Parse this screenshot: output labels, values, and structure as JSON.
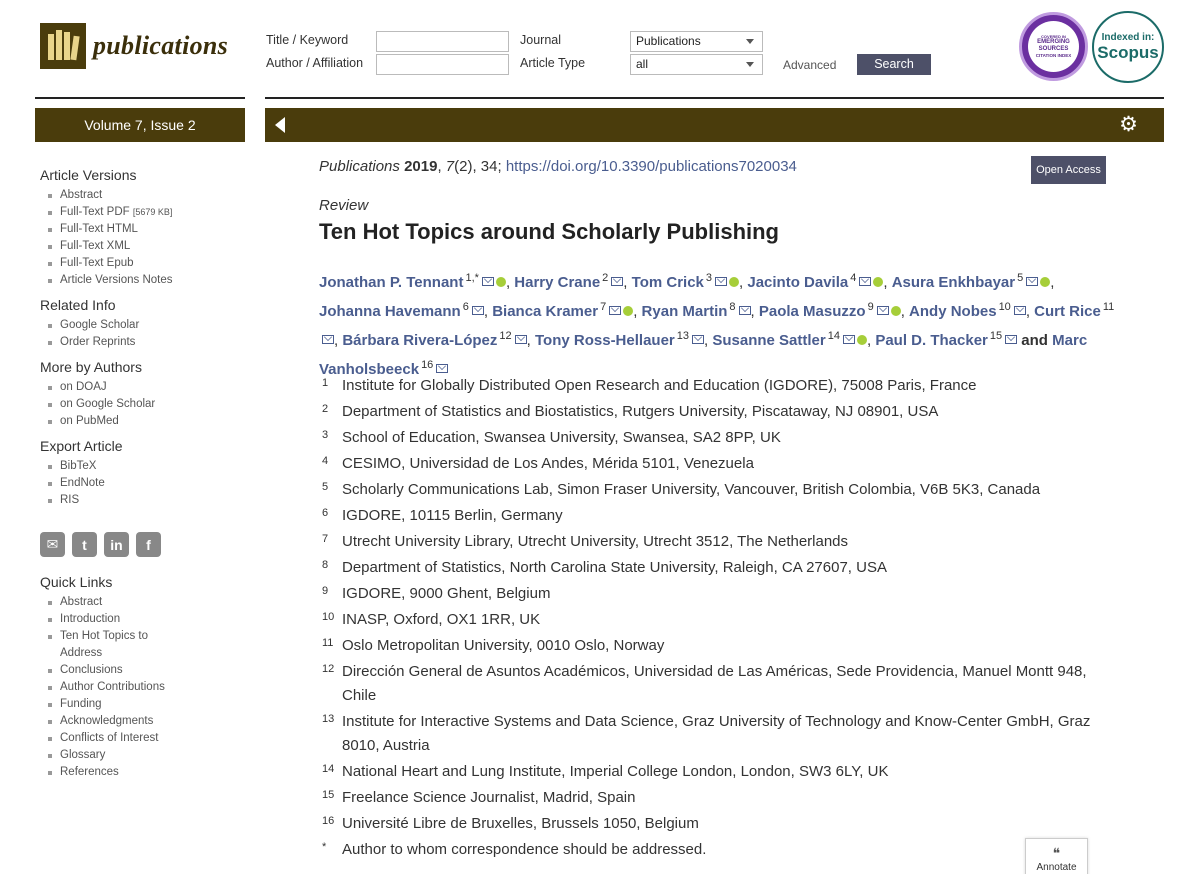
{
  "header": {
    "logo_text": "publications",
    "search": {
      "title_keyword_label": "Title / Keyword",
      "author_affiliation_label": "Author / Affiliation",
      "journal_label": "Journal",
      "journal_value": "Publications",
      "article_type_label": "Article Type",
      "article_type_value": "all",
      "advanced_label": "Advanced",
      "search_label": "Search"
    },
    "badges": {
      "esci_line1": "COVERED IN",
      "esci_line2": "EMERGING",
      "esci_line3": "SOURCES",
      "esci_line4": "CITATION INDEX",
      "scopus_line1": "Indexed in:",
      "scopus_line2": "Scopus"
    }
  },
  "volume_bar": "Volume 7, Issue 2",
  "sidebar": {
    "sections": [
      {
        "heading": "Article Versions",
        "items": [
          "Abstract",
          "Full-Text PDF",
          "Full-Text HTML",
          "Full-Text XML",
          "Full-Text Epub",
          "Article Versions Notes"
        ]
      },
      {
        "heading": "Related Info",
        "items": [
          "Google Scholar",
          "Order Reprints"
        ]
      },
      {
        "heading": "More by Authors",
        "items": [
          "on DOAJ",
          "on Google Scholar",
          "on PubMed"
        ]
      },
      {
        "heading": "Export Article",
        "items": [
          "BibTeX",
          "EndNote",
          "RIS"
        ]
      }
    ],
    "pdf_size": "[5679 KB]",
    "social_icons": [
      "email-icon",
      "twitter-icon",
      "linkedin-icon",
      "facebook-icon"
    ],
    "quick_links": {
      "heading": "Quick Links",
      "items": [
        "Abstract",
        "Introduction",
        "Ten Hot Topics to Address",
        "Conclusions",
        "Author Contributions",
        "Funding",
        "Acknowledgments",
        "Conflicts of Interest",
        "Glossary",
        "References"
      ]
    }
  },
  "article": {
    "journal": "Publications",
    "year": "2019",
    "volume": "7",
    "issue": "(2)",
    "article_no": ", 34; ",
    "doi": "https://doi.org/10.3390/publications7020034",
    "open_access": "Open Access",
    "type": "Review",
    "title": "Ten Hot Topics around Scholarly Publishing",
    "authors": [
      {
        "name": "Jonathan P. Tennant",
        "sup": "1,*",
        "orcid": true
      },
      {
        "name": "Harry Crane",
        "sup": "2",
        "orcid": false
      },
      {
        "name": "Tom Crick",
        "sup": "3",
        "orcid": true
      },
      {
        "name": "Jacinto Davila",
        "sup": "4",
        "orcid": true
      },
      {
        "name": "Asura Enkhbayar",
        "sup": "5",
        "orcid": true
      },
      {
        "name": "Johanna Havemann",
        "sup": "6",
        "orcid": false
      },
      {
        "name": "Bianca Kramer",
        "sup": "7",
        "orcid": true
      },
      {
        "name": "Ryan Martin",
        "sup": "8",
        "orcid": false
      },
      {
        "name": "Paola Masuzzo",
        "sup": "9",
        "orcid": true
      },
      {
        "name": "Andy Nobes",
        "sup": "10",
        "orcid": false
      },
      {
        "name": "Curt Rice",
        "sup": "11",
        "orcid": false
      },
      {
        "name": "Bárbara Rivera-López",
        "sup": "12",
        "orcid": false
      },
      {
        "name": "Tony Ross-Hellauer",
        "sup": "13",
        "orcid": false
      },
      {
        "name": "Susanne Sattler",
        "sup": "14",
        "orcid": true
      },
      {
        "name": "Paul D. Thacker",
        "sup": "15",
        "orcid": false
      },
      {
        "name": "Marc Vanholsbeeck",
        "sup": "16",
        "orcid": false
      }
    ],
    "and_word": "and",
    "affiliations": [
      {
        "num": "1",
        "text": "Institute for Globally Distributed Open Research and Education (IGDORE), 75008 Paris, France"
      },
      {
        "num": "2",
        "text": "Department of Statistics and Biostatistics, Rutgers University, Piscataway, NJ 08901, USA"
      },
      {
        "num": "3",
        "text": "School of Education, Swansea University, Swansea, SA2 8PP, UK"
      },
      {
        "num": "4",
        "text": "CESIMO, Universidad de Los Andes, Mérida 5101, Venezuela"
      },
      {
        "num": "5",
        "text": "Scholarly Communications Lab, Simon Fraser University, Vancouver, British Colombia, V6B 5K3, Canada"
      },
      {
        "num": "6",
        "text": "IGDORE, 10115 Berlin, Germany"
      },
      {
        "num": "7",
        "text": "Utrecht University Library, Utrecht University, Utrecht 3512, The Netherlands"
      },
      {
        "num": "8",
        "text": "Department of Statistics, North Carolina State University, Raleigh, CA 27607, USA"
      },
      {
        "num": "9",
        "text": "IGDORE, 9000 Ghent, Belgium"
      },
      {
        "num": "10",
        "text": "INASP, Oxford, OX1 1RR, UK"
      },
      {
        "num": "11",
        "text": "Oslo Metropolitan University, 0010 Oslo, Norway"
      },
      {
        "num": "12",
        "text": "Dirección General de Asuntos Académicos, Universidad de Las Américas, Sede Providencia, Manuel Montt 948, Chile"
      },
      {
        "num": "13",
        "text": "Institute for Interactive Systems and Data Science, Graz University of Technology and Know-Center GmbH, Graz 8010, Austria"
      },
      {
        "num": "14",
        "text": "National Heart and Lung Institute, Imperial College London, London, SW3 6LY, UK"
      },
      {
        "num": "15",
        "text": "Freelance Science Journalist, Madrid, Spain"
      },
      {
        "num": "16",
        "text": "Université Libre de Bruxelles, Brussels 1050, Belgium"
      },
      {
        "num": "*",
        "text": "Author to whom correspondence should be addressed."
      }
    ]
  },
  "annotate_label": "Annotate",
  "colors": {
    "brand_bar": "#4a3c0c",
    "link": "#4a5d8f",
    "button": "#4d5068",
    "orcid": "#a6ce39"
  }
}
